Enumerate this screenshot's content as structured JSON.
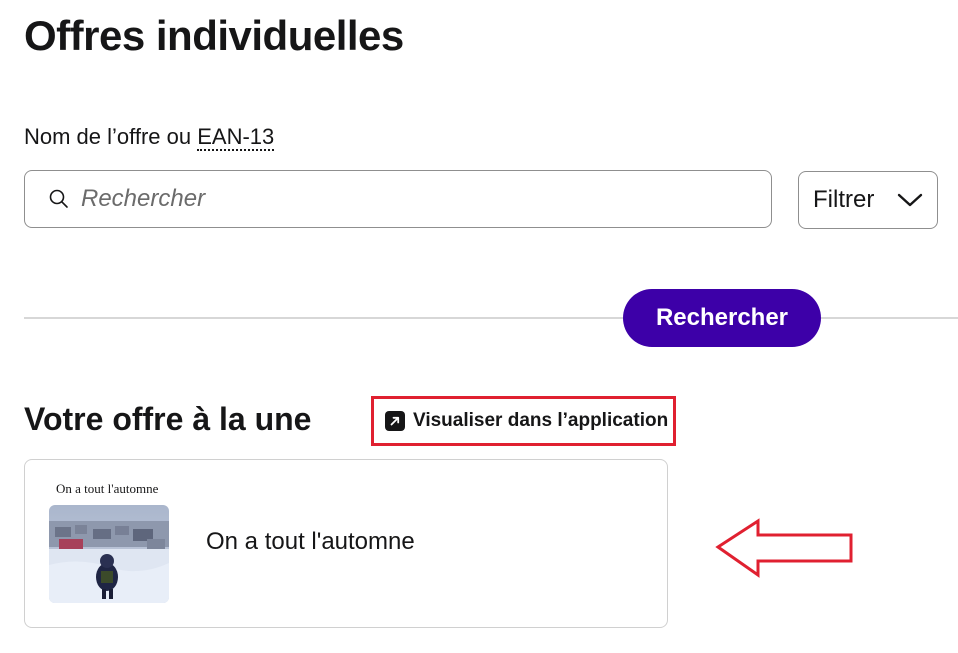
{
  "header": {
    "title": "Offres individuelles"
  },
  "search": {
    "label_prefix": "Nom de l’offre ou ",
    "label_abbr": "EAN-13",
    "placeholder": "Rechercher",
    "filter_label": "Filtrer",
    "submit_label": "Rechercher"
  },
  "featured": {
    "title": "Votre offre à la une",
    "preview_link_label": "Visualiser dans l’application",
    "offer": {
      "thumbnail_caption": "On a tout l'automne",
      "name": "On a tout l'automne"
    }
  },
  "icons": {
    "search": "search-icon",
    "filter_chevron": "chevron-down-icon",
    "external_link": "external-link-icon",
    "annotation_arrow": "arrow-left-icon"
  },
  "colors": {
    "primary": "#3d00a8",
    "text": "#161617",
    "annotation": "#e02030"
  }
}
